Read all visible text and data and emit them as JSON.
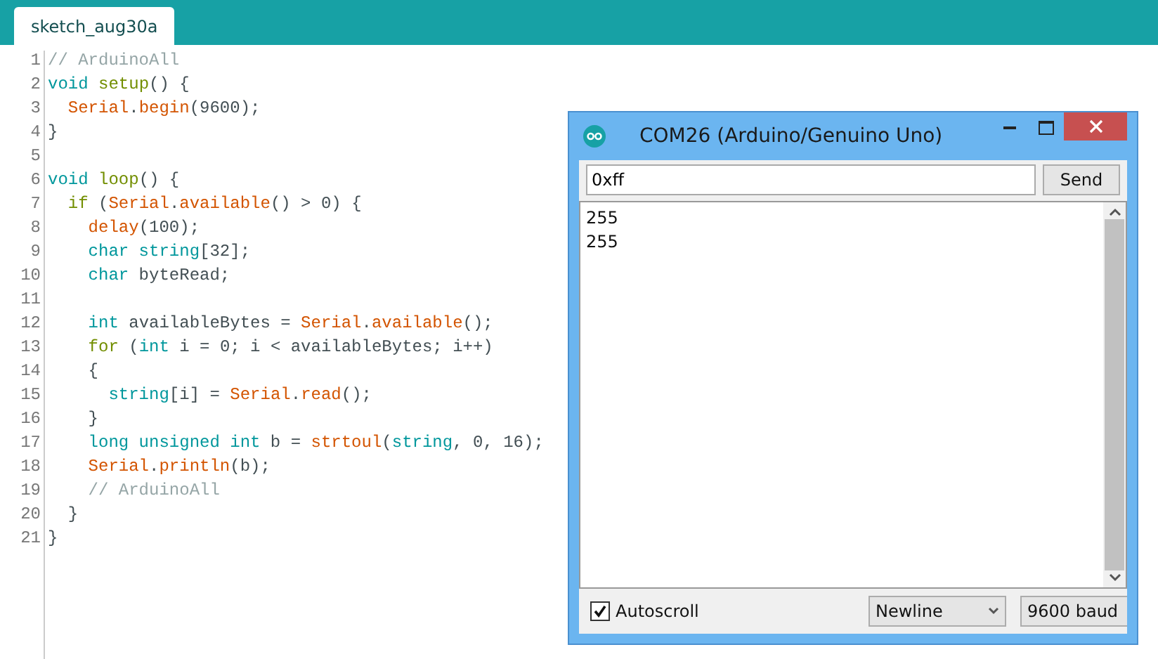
{
  "tabs": [
    {
      "label": "sketch_aug30a",
      "selected": true
    }
  ],
  "editor": {
    "lines": [
      {
        "number": "1",
        "tokens": [
          {
            "text": "// ArduinoAll",
            "kind": "comment"
          }
        ]
      },
      {
        "number": "2",
        "tokens": [
          {
            "text": "void",
            "kind": "type"
          },
          {
            "text": " setup",
            "kind": "keyword"
          },
          {
            "text": "() {",
            "kind": "plain"
          }
        ]
      },
      {
        "number": "3",
        "tokens": [
          {
            "text": "  Serial",
            "kind": "function"
          },
          {
            "text": ".",
            "kind": "plain"
          },
          {
            "text": "begin",
            "kind": "function"
          },
          {
            "text": "(9600);",
            "kind": "plain"
          }
        ]
      },
      {
        "number": "4",
        "tokens": [
          {
            "text": "}",
            "kind": "plain"
          }
        ]
      },
      {
        "number": "5"
      },
      {
        "number": "6",
        "tokens": [
          {
            "text": "void",
            "kind": "type"
          },
          {
            "text": " loop",
            "kind": "keyword"
          },
          {
            "text": "() {",
            "kind": "plain"
          }
        ]
      },
      {
        "number": "7",
        "tokens": [
          {
            "text": "  if",
            "kind": "keyword"
          },
          {
            "text": " (",
            "kind": "plain"
          },
          {
            "text": "Serial",
            "kind": "function"
          },
          {
            "text": ".",
            "kind": "plain"
          },
          {
            "text": "available",
            "kind": "function"
          },
          {
            "text": "() > 0) {",
            "kind": "plain"
          }
        ]
      },
      {
        "number": "8",
        "tokens": [
          {
            "text": "    delay",
            "kind": "function"
          },
          {
            "text": "(100);",
            "kind": "plain"
          }
        ]
      },
      {
        "number": "9",
        "tokens": [
          {
            "text": "    char",
            "kind": "type"
          },
          {
            "text": " string",
            "kind": "type"
          },
          {
            "text": "[32];",
            "kind": "plain"
          }
        ]
      },
      {
        "number": "10",
        "tokens": [
          {
            "text": "    char",
            "kind": "type"
          },
          {
            "text": " byteRead;",
            "kind": "plain"
          }
        ]
      },
      {
        "number": "11"
      },
      {
        "number": "12",
        "tokens": [
          {
            "text": "    int",
            "kind": "type"
          },
          {
            "text": " availableBytes = ",
            "kind": "plain"
          },
          {
            "text": "Serial",
            "kind": "function"
          },
          {
            "text": ".",
            "kind": "plain"
          },
          {
            "text": "available",
            "kind": "function"
          },
          {
            "text": "();",
            "kind": "plain"
          }
        ]
      },
      {
        "number": "13",
        "tokens": [
          {
            "text": "    for",
            "kind": "keyword"
          },
          {
            "text": " (",
            "kind": "plain"
          },
          {
            "text": "int",
            "kind": "type"
          },
          {
            "text": " i = 0; i < availableBytes; i++)",
            "kind": "plain"
          }
        ]
      },
      {
        "number": "14",
        "tokens": [
          {
            "text": "    {",
            "kind": "plain"
          }
        ]
      },
      {
        "number": "15",
        "tokens": [
          {
            "text": "      string",
            "kind": "type"
          },
          {
            "text": "[i] = ",
            "kind": "plain"
          },
          {
            "text": "Serial",
            "kind": "function"
          },
          {
            "text": ".",
            "kind": "plain"
          },
          {
            "text": "read",
            "kind": "function"
          },
          {
            "text": "();",
            "kind": "plain"
          }
        ]
      },
      {
        "number": "16",
        "tokens": [
          {
            "text": "    }",
            "kind": "plain"
          }
        ]
      },
      {
        "number": "17",
        "tokens": [
          {
            "text": "    long",
            "kind": "type"
          },
          {
            "text": " unsigned",
            "kind": "type"
          },
          {
            "text": " int",
            "kind": "type"
          },
          {
            "text": " b = ",
            "kind": "plain"
          },
          {
            "text": "strtoul",
            "kind": "function"
          },
          {
            "text": "(",
            "kind": "plain"
          },
          {
            "text": "string",
            "kind": "type"
          },
          {
            "text": ", 0, 16);",
            "kind": "plain"
          }
        ]
      },
      {
        "number": "18",
        "tokens": [
          {
            "text": "    Serial",
            "kind": "function"
          },
          {
            "text": ".",
            "kind": "plain"
          },
          {
            "text": "println",
            "kind": "function"
          },
          {
            "text": "(b);",
            "kind": "plain"
          }
        ]
      },
      {
        "number": "19",
        "tokens": [
          {
            "text": "    // ArduinoAll",
            "kind": "comment"
          }
        ]
      },
      {
        "number": "20",
        "tokens": [
          {
            "text": "  }",
            "kind": "plain"
          }
        ]
      },
      {
        "number": "21",
        "tokens": [
          {
            "text": "}",
            "kind": "plain"
          }
        ]
      }
    ]
  },
  "serial_monitor": {
    "title": "COM26 (Arduino/Genuino Uno)",
    "input": {
      "value": "0xff"
    },
    "send_button": "Send",
    "output": [
      "255",
      "255"
    ],
    "autoscroll": {
      "label": "Autoscroll",
      "checked": true
    },
    "line_ending": "Newline",
    "baud_rate": "9600 baud"
  }
}
